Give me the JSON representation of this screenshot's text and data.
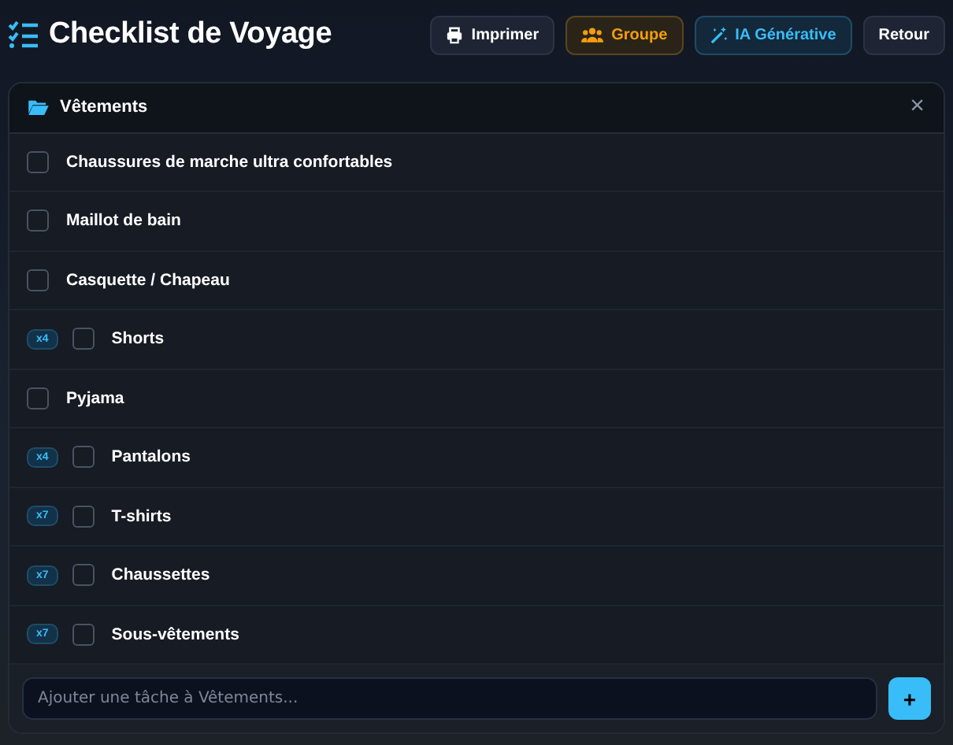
{
  "title": "Checklist de Voyage",
  "buttons": [
    {
      "label": "Imprimer",
      "kind": "print"
    },
    {
      "label": "Groupe",
      "kind": "group"
    },
    {
      "label": "IA Générative",
      "kind": "ai"
    },
    {
      "label": "Retour",
      "kind": "back"
    }
  ],
  "category": {
    "title": "Vêtements",
    "close": "×"
  },
  "items": [
    {
      "label": "Chaussures de marche ultra confortables",
      "checked": false
    },
    {
      "label": "Maillot de bain",
      "checked": false
    },
    {
      "label": "Casquette / Chapeau",
      "checked": false
    },
    {
      "label": "Shorts",
      "checked": false,
      "quantity": "x4"
    },
    {
      "label": "Pyjama",
      "checked": false
    },
    {
      "label": "Pantalons",
      "checked": false,
      "quantity": "x4"
    },
    {
      "label": "T-shirts",
      "checked": false,
      "quantity": "x7"
    },
    {
      "label": "Chaussettes",
      "checked": false,
      "quantity": "x7"
    },
    {
      "label": "Sous-vêtements",
      "checked": false,
      "quantity": "x7"
    }
  ],
  "input": {
    "placeholder": "Ajouter une tâche à Vêtements...",
    "add": "+"
  }
}
